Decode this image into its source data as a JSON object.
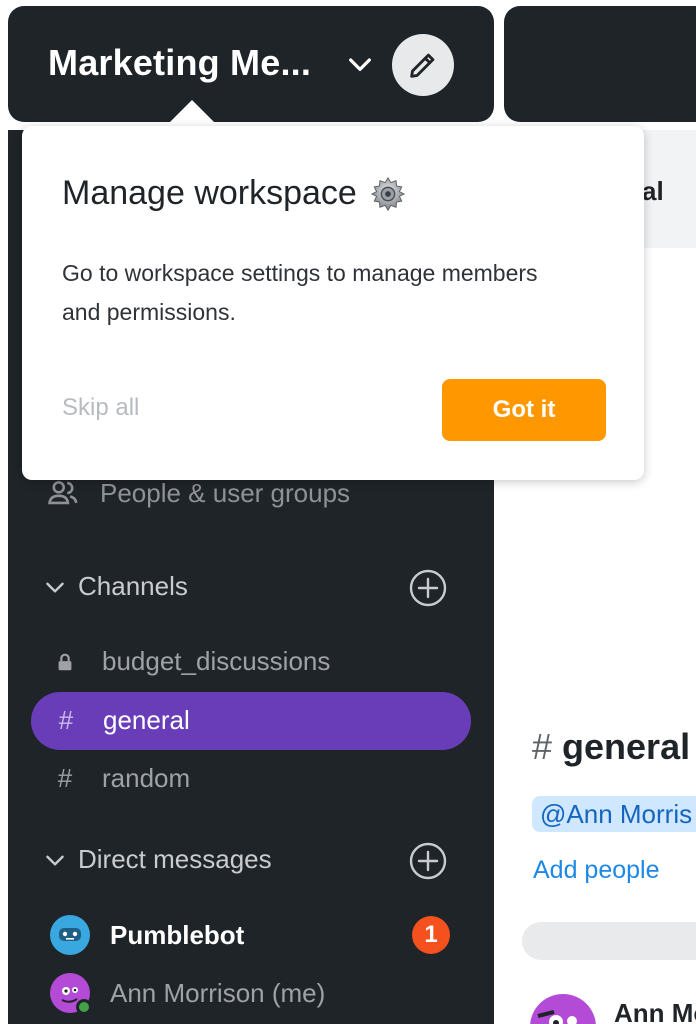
{
  "workspace": {
    "name": "Marketing Me...",
    "chevron_icon": "chevron-down-icon",
    "edit_icon": "pencil-icon"
  },
  "popover": {
    "title": "Manage workspace",
    "title_icon": "gear-icon",
    "body": "Go to workspace settings to manage members and permissions.",
    "skip_label": "Skip all",
    "confirm_label": "Got it"
  },
  "sidebar": {
    "people_label": "People & user groups",
    "channels_header": "Channels",
    "channels": [
      {
        "label": "budget_discussions",
        "icon": "lock-icon",
        "active": false
      },
      {
        "label": "general",
        "icon": "#",
        "active": true
      },
      {
        "label": "random",
        "icon": "#",
        "active": false
      }
    ],
    "dm_header": "Direct messages",
    "dms": [
      {
        "label": "Pumblebot",
        "unread": "1",
        "bold": true
      },
      {
        "label": "Ann Morrison (me)",
        "unread": "",
        "bold": false
      }
    ]
  },
  "main": {
    "strip_partial": "al",
    "channel_title": "general",
    "channel_hash": "#",
    "mention": "@Ann Morris",
    "add_people": "Add people",
    "message_author": "Ann Mo"
  },
  "colors": {
    "sidebar_bg": "#1f2428",
    "active_channel": "#6a3db8",
    "accent_button": "#ff9800",
    "badge": "#f4511e",
    "link": "#1e88e5"
  }
}
